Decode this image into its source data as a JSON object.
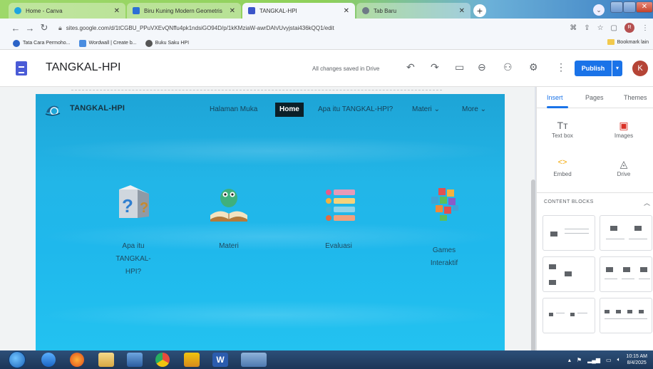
{
  "browser": {
    "tabs": [
      {
        "title": "Home - Canva",
        "color": "#1fa5e0",
        "active": false
      },
      {
        "title": "Biru Kuning Modern Geometris",
        "color": "#2d6fd6",
        "active": false
      },
      {
        "title": "TANGKAL-HPI",
        "color": "#3b55c9",
        "active": true
      },
      {
        "title": "Tab Baru",
        "color": "#6e7a86",
        "active": false
      }
    ],
    "new_tab": "+",
    "url": "sites.google.com/d/1tCGBU_PPuVXEvQNffu4pk1ndsiGO94D/p/1kKMziaW-awrDAh/Uvyjstai436kQQ1/edit",
    "bookmarks": [
      {
        "label": "Tata Cara Permoho...",
        "color": "#2b63c7"
      },
      {
        "label": "Wordwall | Create b...",
        "color": "#4a8de0"
      },
      {
        "label": "Buku Saku HPI",
        "color": "#555"
      }
    ],
    "bookmarks_right": "Bookmark lain",
    "profile_initial": "R"
  },
  "sites": {
    "title": "TANGKAL-HPI",
    "saved_status": "All changes saved in Drive",
    "publish_label": "Publish",
    "user_initial": "K"
  },
  "site": {
    "name": "TANGKAL-HPI",
    "nav": [
      {
        "label": "Halaman Muka",
        "active": false
      },
      {
        "label": "Home",
        "active": true
      },
      {
        "label": "Apa itu TANGKAL-HPI?",
        "active": false
      },
      {
        "label": "Materi",
        "active": false,
        "dropdown": true
      },
      {
        "label": "More",
        "active": false,
        "dropdown": true
      }
    ],
    "cards": [
      {
        "label": "Apa itu TANGKAL-HPI?",
        "lines": [
          "Apa itu",
          "TANGKAL-",
          "HPI?"
        ],
        "icon": "question-cube-icon"
      },
      {
        "label": "Materi",
        "lines": [
          "Materi"
        ],
        "icon": "reading-book-icon"
      },
      {
        "label": "Evaluasi",
        "lines": [
          "Evaluasi"
        ],
        "icon": "checklist-icon"
      },
      {
        "label": "Games Interaktif",
        "lines": [
          "Games",
          "Interaktif"
        ],
        "icon": "game-blocks-icon"
      }
    ]
  },
  "panel": {
    "tabs": [
      "Insert",
      "Pages",
      "Themes"
    ],
    "active_tab": "Insert",
    "items": [
      {
        "label": "Text box",
        "icon": "text-box-icon",
        "glyph": "Tт"
      },
      {
        "label": "Images",
        "icon": "image-icon",
        "glyph": "▣"
      },
      {
        "label": "Embed",
        "icon": "embed-icon",
        "glyph": "<>"
      },
      {
        "label": "Drive",
        "icon": "drive-icon",
        "glyph": "◬"
      }
    ],
    "content_blocks_label": "CONTENT BLOCKS"
  },
  "taskbar": {
    "time": "10:15 AM",
    "date": "8/4/2025"
  }
}
